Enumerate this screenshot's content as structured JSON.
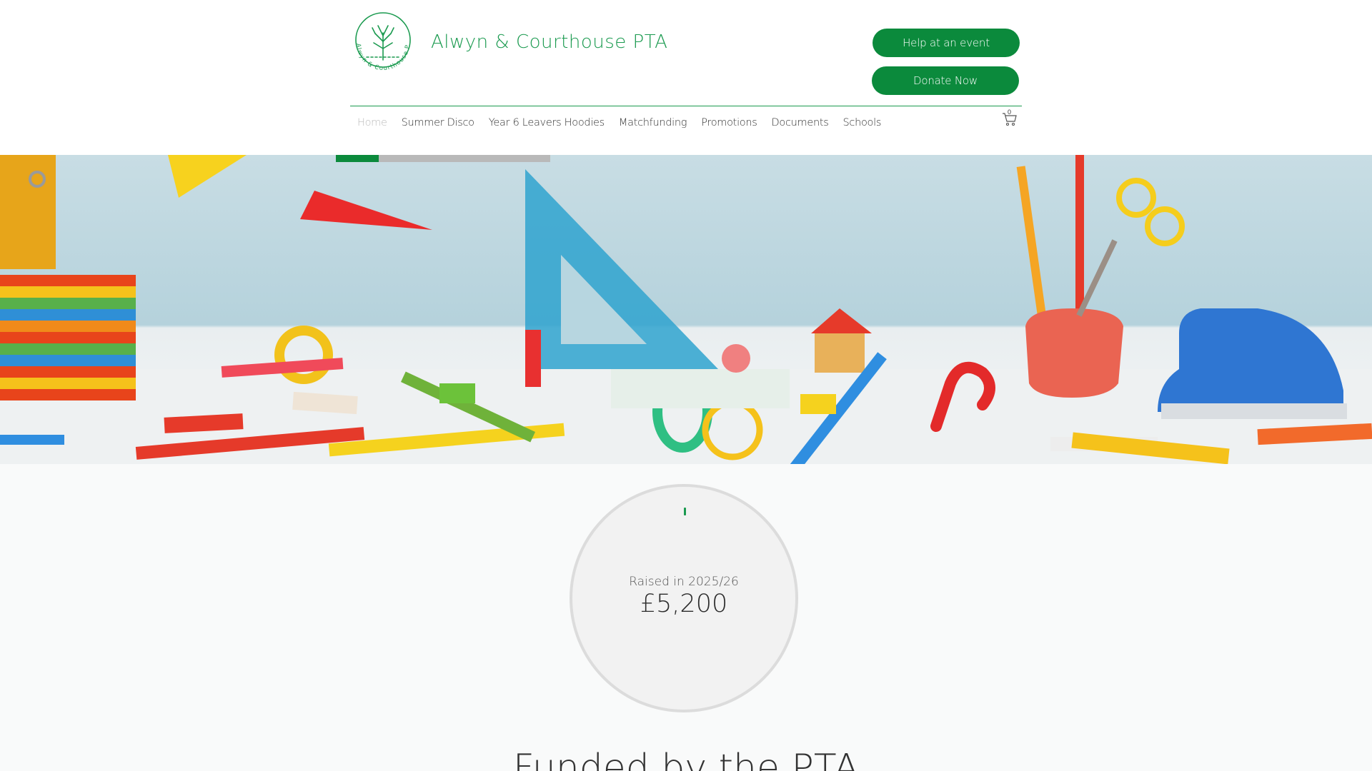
{
  "header": {
    "logo_text": "Alwyn & Courthouse PTA",
    "site_title": "Alwyn & Courthouse PTA",
    "help_button": "Help at an event",
    "donate_button": "Donate Now",
    "cart_count": "0"
  },
  "nav": {
    "items": [
      {
        "label": "Home",
        "active": true
      },
      {
        "label": "Summer Disco",
        "active": false
      },
      {
        "label": "Year 6 Leavers Hoodies",
        "active": false
      },
      {
        "label": "Matchfunding",
        "active": false
      },
      {
        "label": "Promotions",
        "active": false
      },
      {
        "label": "Documents",
        "active": false
      },
      {
        "label": "Schools",
        "active": false
      }
    ]
  },
  "hero": {
    "slide_progress": 0.2
  },
  "raised": {
    "label": "Raised in 2025/26",
    "amount": "£5,200"
  },
  "section_heading": "Funded by the PTA",
  "colors": {
    "brand_green": "#0b8a3c",
    "title_green": "#1a9a4f"
  }
}
